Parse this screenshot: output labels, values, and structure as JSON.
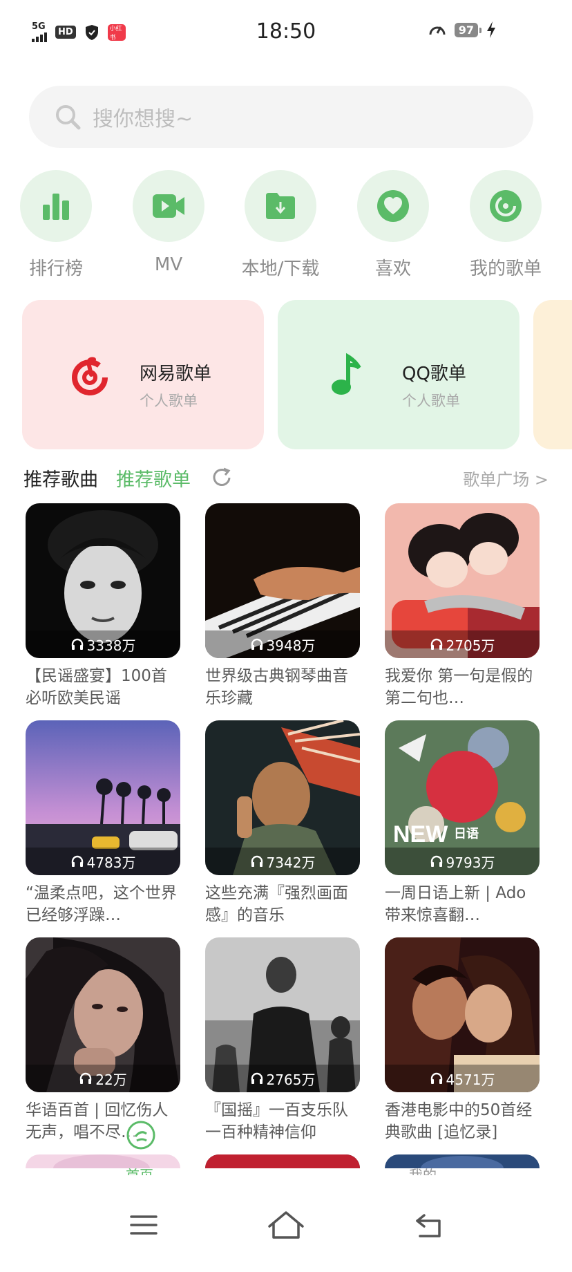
{
  "status_bar": {
    "network": "5G",
    "hd": "HD",
    "app_badge": "小红书",
    "time": "18:50",
    "battery": "97"
  },
  "search": {
    "placeholder": "搜你想搜~"
  },
  "shortcuts": [
    {
      "label": "排行榜",
      "icon": "chart-bars-icon"
    },
    {
      "label": "MV",
      "icon": "video-camera-icon"
    },
    {
      "label": "本地/下载",
      "icon": "folder-download-icon"
    },
    {
      "label": "喜欢",
      "icon": "heart-icon"
    },
    {
      "label": "我的歌单",
      "icon": "disc-icon"
    }
  ],
  "playlist_cards": [
    {
      "title": "网易歌单",
      "subtitle": "个人歌单",
      "icon": "netease-logo-icon",
      "color": "#fde6e6"
    },
    {
      "title": "QQ歌单",
      "subtitle": "个人歌单",
      "icon": "music-note-icon",
      "color": "#e2f5e6"
    }
  ],
  "section": {
    "tab_songs": "推荐歌曲",
    "tab_playlists": "推荐歌单",
    "more": "歌单广场 >"
  },
  "playlists": [
    {
      "count": "3338万",
      "title": "【民谣盛宴】100首必听欧美民谣"
    },
    {
      "count": "3948万",
      "title": "世界级古典钢琴曲音乐珍藏"
    },
    {
      "count": "2705万",
      "title": "我爱你 第一句是假的 第二句也…"
    },
    {
      "count": "4783万",
      "title": "“温柔点吧，这个世界已经够浮躁…"
    },
    {
      "count": "7342万",
      "title": "这些充满『强烈画面感』的音乐"
    },
    {
      "count": "9793万",
      "title": "一周日语上新 | Ado带来惊喜翻…"
    },
    {
      "count": "22万",
      "title": "华语百首 | 回忆伤人无声，唱不尽…"
    },
    {
      "count": "2765万",
      "title": "『国摇』一百支乐队一百种精神信仰"
    },
    {
      "count": "4571万",
      "title": "香港电影中的50首经典歌曲 [追忆录]"
    }
  ],
  "bottom_tabs": {
    "home": "首页",
    "mine": "我的"
  },
  "colors": {
    "accent": "#5bbb68",
    "netease": "#e0262e",
    "qq": "#2cb34a"
  }
}
